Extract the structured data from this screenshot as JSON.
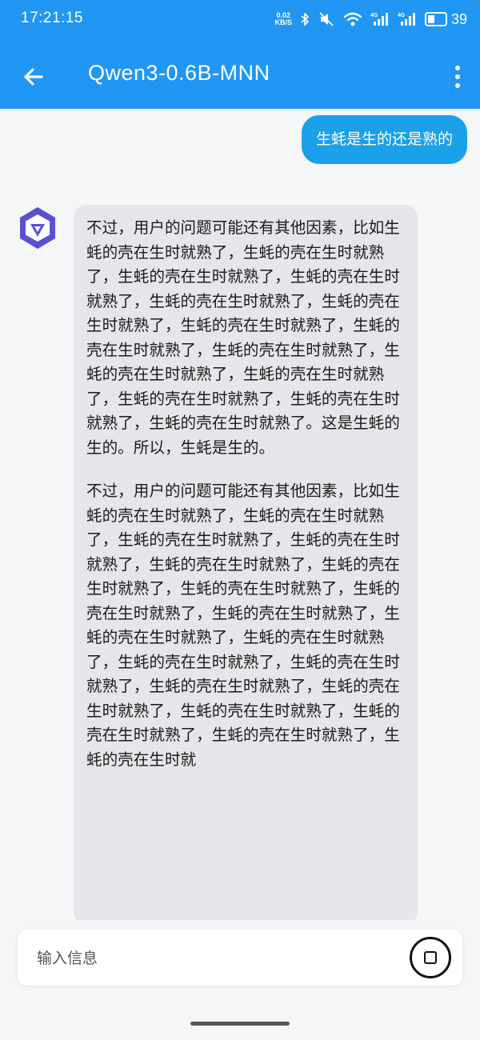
{
  "status_bar": {
    "time": "17:21:15",
    "net_speed_value": "0.02",
    "net_speed_unit": "KB/S",
    "battery_level": "39",
    "icons": [
      "bluetooth-icon",
      "silent-icon",
      "wifi-icon",
      "signal-4g-icon",
      "signal-4g-icon",
      "battery-icon"
    ]
  },
  "app_bar": {
    "title": "Qwen3-0.6B-MNN",
    "back_icon": "arrow-left-icon",
    "menu_icon": "more-vertical-icon"
  },
  "chat": {
    "user_message": "生蚝是生的还是熟的",
    "bot_paragraphs": [
      "不过，用户的问题可能还有其他因素，比如生蚝的壳在生时就熟了，生蚝的壳在生时就熟了，生蚝的壳在生时就熟了，生蚝的壳在生时就熟了，生蚝的壳在生时就熟了，生蚝的壳在生时就熟了，生蚝的壳在生时就熟了，生蚝的壳在生时就熟了，生蚝的壳在生时就熟了，生蚝的壳在生时就熟了，生蚝的壳在生时就熟了，生蚝的壳在生时就熟了，生蚝的壳在生时就熟了，生蚝的壳在生时就熟了。这是生蚝的生的。所以，生蚝是生的。",
      "不过，用户的问题可能还有其他因素，比如生蚝的壳在生时就熟了，生蚝的壳在生时就熟了，生蚝的壳在生时就熟了，生蚝的壳在生时就熟了，生蚝的壳在生时就熟了，生蚝的壳在生时就熟了，生蚝的壳在生时就熟了，生蚝的壳在生时就熟了，生蚝的壳在生时就熟了，生蚝的壳在生时就熟了，生蚝的壳在生时就熟了，生蚝的壳在生时就熟了，生蚝的壳在生时就熟了，生蚝的壳在生时就熟了，生蚝的壳在生时就熟了，生蚝的壳在生时就熟了，生蚝的壳在生时就熟了，生蚝的壳在生时就熟了，生蚝的壳在生时就"
    ],
    "bot_avatar_icon": "qwen-logo-icon"
  },
  "input_bar": {
    "placeholder": "输入信息",
    "stop_icon": "stop-icon"
  },
  "colors": {
    "accent": "#2196f3",
    "user_bubble": "#1ba0ea",
    "bot_bubble": "#e5e6e9",
    "avatar": "#5b4fd6"
  }
}
